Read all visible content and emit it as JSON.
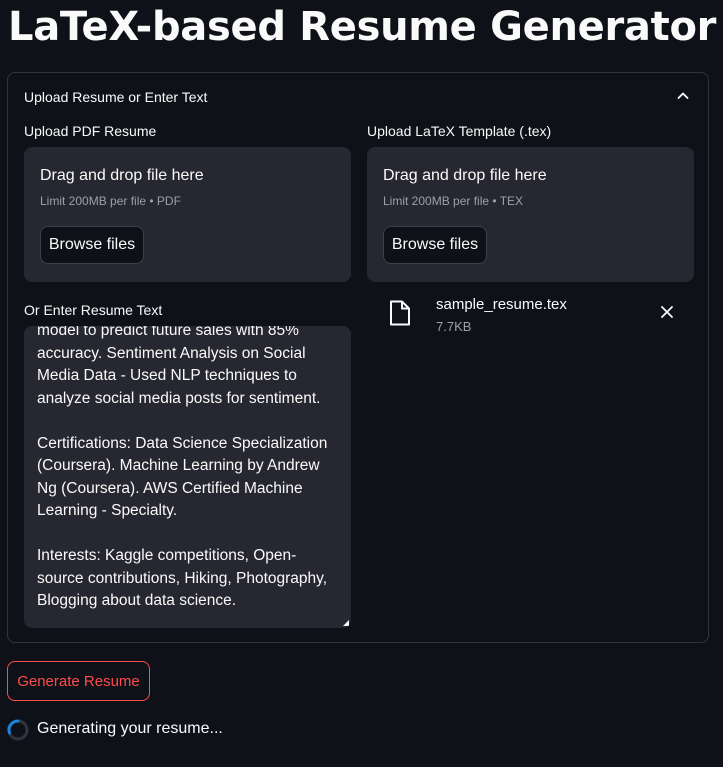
{
  "page": {
    "title": "LaTeX-based Resume Generator"
  },
  "expander": {
    "header": "Upload Resume or Enter Text",
    "chevron_icon": "chevron-up-icon"
  },
  "pdf_upload": {
    "label": "Upload PDF Resume",
    "drag_text": "Drag and drop file here",
    "limit_text": "Limit 200MB per file • PDF",
    "browse_label": "Browse files"
  },
  "tex_upload": {
    "label": "Upload LaTeX Template (.tex)",
    "drag_text": "Drag and drop file here",
    "limit_text": "Limit 200MB per file • TEX",
    "browse_label": "Browse files",
    "uploaded_file": {
      "name": "sample_resume.tex",
      "size": "7.7KB",
      "icon": "file-icon",
      "remove_icon": "close-icon"
    }
  },
  "resume_text": {
    "label": "Or Enter Resume Text",
    "value": "model to predict future sales with 85% accuracy. Sentiment Analysis on Social Media Data - Used NLP techniques to analyze social media posts for sentiment.\n\nCertifications: Data Science Specialization (Coursera). Machine Learning by Andrew Ng (Coursera). AWS Certified Machine Learning - Specialty.\n\nInterests: Kaggle competitions, Open-source contributions, Hiking, Photography, Blogging about data science."
  },
  "actions": {
    "generate_label": "Generate Resume"
  },
  "status": {
    "text": "Generating your resume...",
    "icon": "spinner-icon"
  },
  "colors": {
    "background": "#0e1117",
    "surface": "#262730",
    "accent": "#ff4b4b",
    "spinner": "#1c83e1"
  }
}
